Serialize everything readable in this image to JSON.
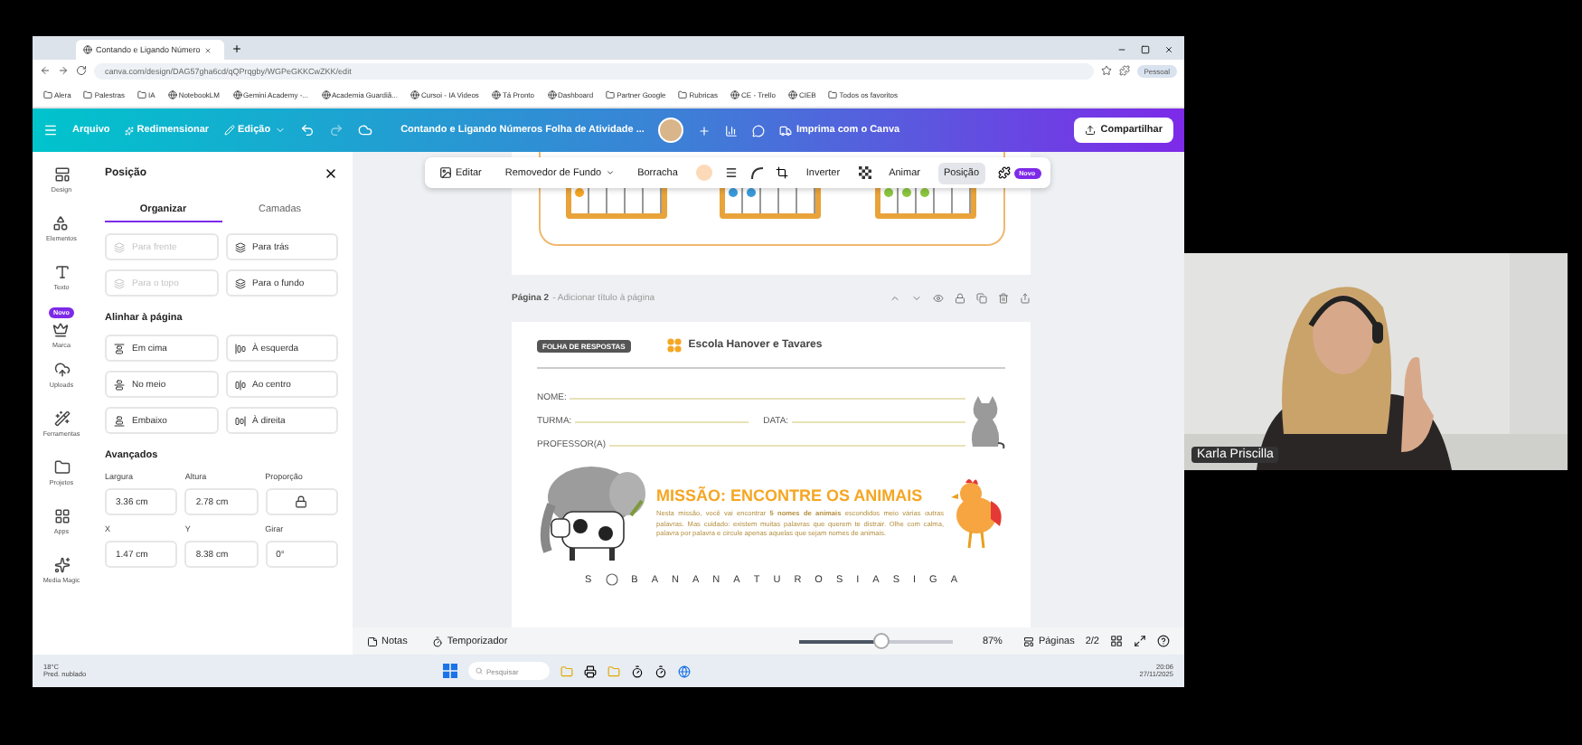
{
  "browser": {
    "tabs": [
      {
        "title": "Contando e Ligando Número",
        "selected": true
      }
    ],
    "url": "canva.com/design/DAG57gha6cd/qQPrqgby/WGPeGKKCwZKK/edit",
    "profile": "Pessoal",
    "bookmarks": [
      {
        "label": "Alera",
        "kind": "folder"
      },
      {
        "label": "Palestras",
        "kind": "folder"
      },
      {
        "label": "IA",
        "kind": "folder"
      },
      {
        "label": "NotebookLM",
        "kind": "site"
      },
      {
        "label": "Gemini Academy -...",
        "kind": "site"
      },
      {
        "label": "Academia Guardiã...",
        "kind": "site"
      },
      {
        "label": "Cursoi - IA Videos",
        "kind": "site"
      },
      {
        "label": "Tá Pronto",
        "kind": "site"
      },
      {
        "label": "Dashboard",
        "kind": "site"
      },
      {
        "label": "Partner Google",
        "kind": "folder"
      },
      {
        "label": "Rubricas",
        "kind": "folder"
      },
      {
        "label": "CE - Trello",
        "kind": "site"
      },
      {
        "label": "CIEB",
        "kind": "site"
      },
      {
        "label": "Todos os favoritos",
        "kind": "folder"
      }
    ]
  },
  "header": {
    "file": "Arquivo",
    "resize": "Redimensionar",
    "edit": "Edição",
    "title": "Contando e Ligando Números Folha de Atividade ...",
    "print": "Imprima com o Canva",
    "share": "Compartilhar"
  },
  "rail": [
    {
      "label": "Design"
    },
    {
      "label": "Elementos"
    },
    {
      "label": "Texto"
    },
    {
      "label": "Marca",
      "badge": "Novo"
    },
    {
      "label": "Uploads"
    },
    {
      "label": "Ferramentas"
    },
    {
      "label": "Projetos"
    },
    {
      "label": "Apps"
    },
    {
      "label": "Media Magic"
    }
  ],
  "panel": {
    "title": "Posição",
    "tabs": [
      {
        "label": "Organizar",
        "selected": true
      },
      {
        "label": "Camadas",
        "selected": false
      }
    ],
    "arrange": [
      {
        "label": "Para frente",
        "disabled": true
      },
      {
        "label": "Para trás",
        "disabled": false
      },
      {
        "label": "Para o topo",
        "disabled": true
      },
      {
        "label": "Para o fundo",
        "disabled": false
      }
    ],
    "align_heading": "Alinhar à página",
    "align": [
      {
        "label": "Em cima"
      },
      {
        "label": "À esquerda"
      },
      {
        "label": "No meio"
      },
      {
        "label": "Ao centro"
      },
      {
        "label": "Embaixo"
      },
      {
        "label": "À direita"
      }
    ],
    "advanced_heading": "Avançados",
    "fields": [
      {
        "label": "Largura",
        "value": "3.36 cm",
        "kind": "text"
      },
      {
        "label": "Altura",
        "value": "2.78 cm",
        "kind": "text"
      },
      {
        "label": "Proporção",
        "kind": "lock"
      },
      {
        "label": "X",
        "value": "1.47 cm",
        "kind": "text"
      },
      {
        "label": "Y",
        "value": "8.38 cm",
        "kind": "text"
      },
      {
        "label": "Girar",
        "value": "0°",
        "kind": "text"
      }
    ]
  },
  "toolbar": [
    {
      "kind": "button",
      "label": "Editar",
      "selected": false
    },
    {
      "kind": "button",
      "label": "Removedor de Fundo",
      "selected": false
    },
    {
      "kind": "button",
      "label": "Borracha",
      "selected": false
    },
    {
      "kind": "swatch",
      "color": "#fcd9b8"
    },
    {
      "kind": "lines"
    },
    {
      "kind": "curve"
    },
    {
      "kind": "crop"
    },
    {
      "kind": "button",
      "label": "Inverter",
      "selected": false
    },
    {
      "kind": "checker"
    },
    {
      "kind": "button",
      "label": "Animar",
      "selected": false
    },
    {
      "kind": "button",
      "label": "Posição",
      "selected": true
    },
    {
      "kind": "badge",
      "label": "Novo"
    }
  ],
  "page1": {
    "grids": [
      {
        "color": "#f5a623"
      },
      {
        "color": "#3a9bdc"
      },
      {
        "color": "#8cc63f"
      }
    ]
  },
  "page2": {
    "label": "Página 2",
    "title_placeholder": "- Adicionar título à página",
    "badge": "FOLHA DE RESPOSTAS",
    "school": "Escola Hanover e Tavares",
    "fields": [
      "NOME:",
      "TURMA:",
      "DATA:",
      "PROFESSOR(A)"
    ],
    "mission_title": "MISSÃO: ENCONTRE OS ANIMAIS",
    "mission_text": "Nesta missão, você vai encontrar **5 nomes de animais** escondidos meio várias outras palavras. Mas cuidado: existem muitas palavras que querem te distrair. Olhe com calma, palavra por palavra e circule apenas aquelas que sejam nomes de animais.",
    "letters": [
      "S",
      "B",
      "A",
      "N",
      "A",
      "N",
      "A",
      "T",
      "U",
      "R",
      "O",
      "S",
      "I",
      "A",
      "S",
      "I",
      "G",
      "A"
    ]
  },
  "bottom_bar": {
    "notes": "Notas",
    "timer": "Temporizador",
    "zoom": {
      "level": 0.53
    },
    "zoom_reading": "87%",
    "pages": "Páginas",
    "page_count": "2/2"
  },
  "taskbar": {
    "weather": "18°C",
    "weather_note": "Pred. nublado",
    "search": "Pesquisar",
    "time": "20:06",
    "date": "27/11/2025"
  },
  "video": {
    "name": "Karla Priscilla"
  }
}
